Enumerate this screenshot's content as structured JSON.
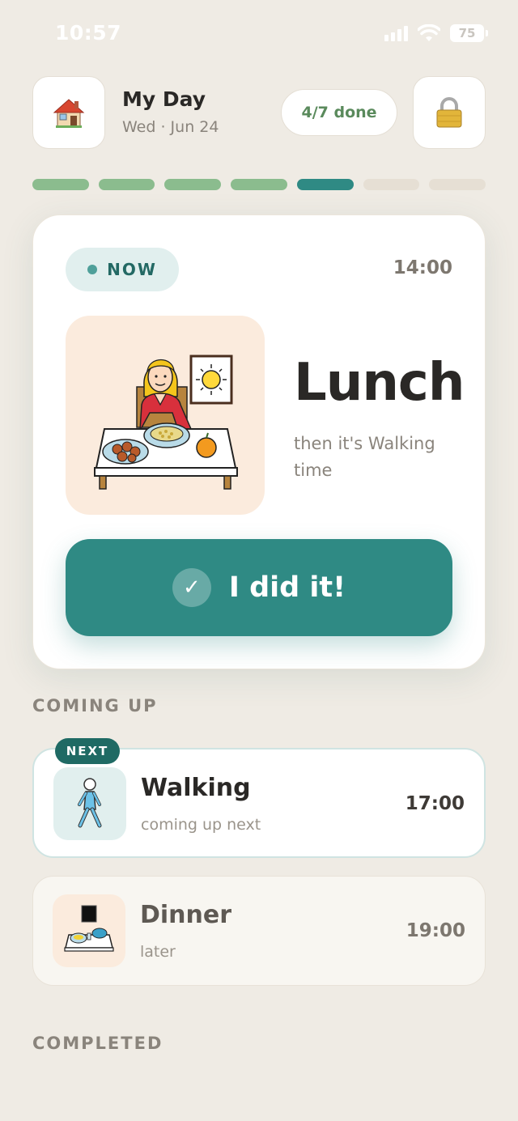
{
  "status_bar": {
    "time": "10:57",
    "battery": "75"
  },
  "header": {
    "title": "My Day",
    "date": "Wed · Jun 24",
    "progress_label": "4/7 done",
    "home_icon": "house-icon",
    "lock_icon": "padlock-icon"
  },
  "progress": {
    "total": 7,
    "completed": 4,
    "current_index": 4,
    "colors": {
      "completed": "#8bbc8e",
      "current": "#2f8a84",
      "upcoming": "#e6dfd4"
    }
  },
  "now_card": {
    "badge": "NOW",
    "time": "14:00",
    "title": "Lunch",
    "subtitle": "then it's Walking time",
    "picture": "woman-eating-lunch-illustration",
    "button_label": "I did it!",
    "button_icon": "check-icon"
  },
  "coming_up": {
    "heading": "COMING UP",
    "items": [
      {
        "tag": "NEXT",
        "title": "Walking",
        "subtitle": "coming up next",
        "time": "17:00",
        "icon": "walking-person-icon"
      },
      {
        "title": "Dinner",
        "subtitle": "later",
        "time": "19:00",
        "icon": "dinner-table-night-icon"
      }
    ]
  },
  "completed": {
    "heading": "COMPLETED"
  },
  "colors": {
    "background": "#efebe4",
    "accent": "#2f8a84",
    "progress_text": "#5a8a5c"
  }
}
